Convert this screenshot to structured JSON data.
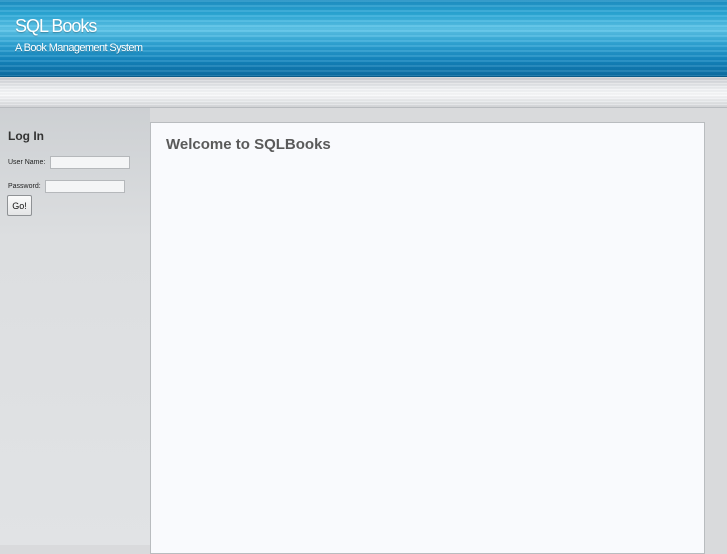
{
  "header": {
    "title": "SQL Books",
    "subtitle": "A Book Management System"
  },
  "sidebar": {
    "login_heading": "Log In",
    "username_label": "User Name:",
    "username_value": "",
    "password_label": "Password:",
    "password_value": "",
    "go_button_label": "Go!"
  },
  "main": {
    "title": "Welcome to SQLBooks"
  }
}
